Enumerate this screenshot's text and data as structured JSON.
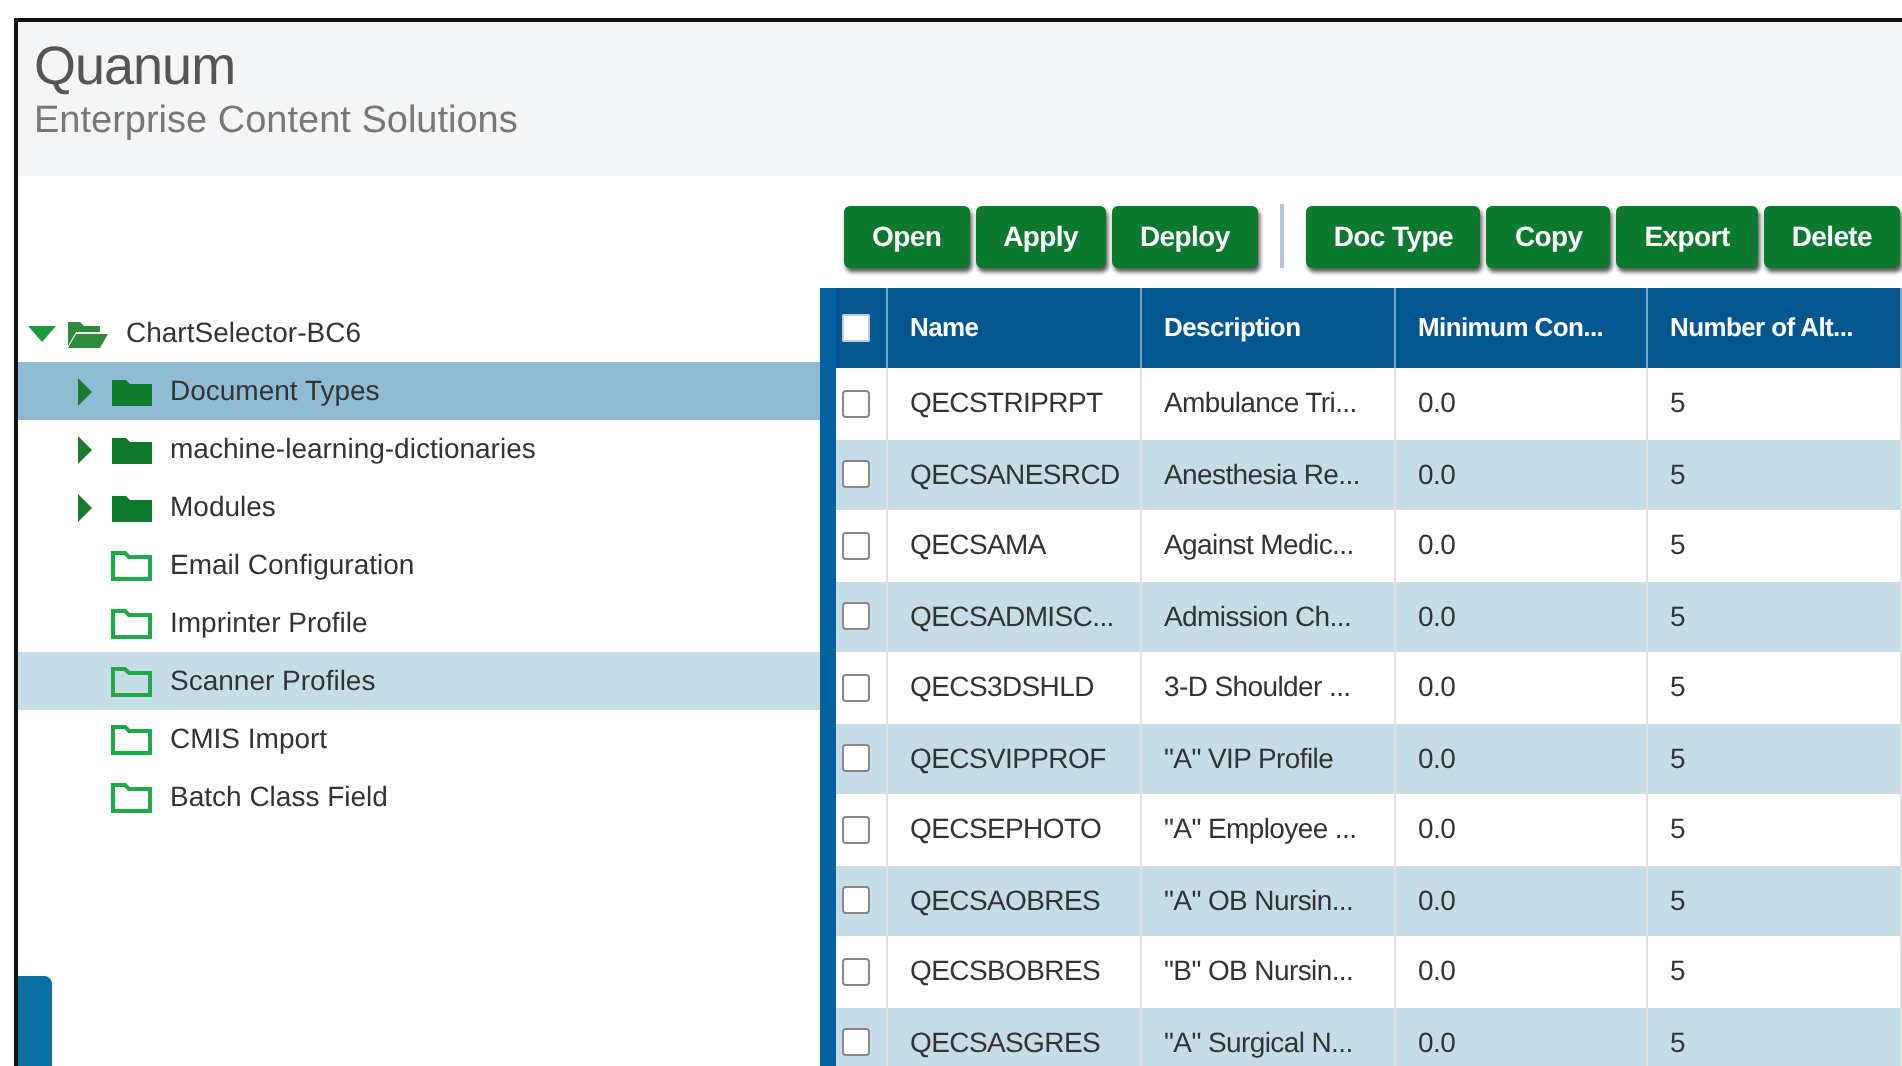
{
  "header": {
    "brand": "Quanum",
    "subtitle": "Enterprise Content Solutions"
  },
  "tree": [
    {
      "label": "ChartSelector-BC6",
      "expandable": true,
      "expanded": true,
      "selected": false,
      "hovered": false,
      "children": [
        {
          "label": "Document Types",
          "expandable": true,
          "expanded": false,
          "selected": true,
          "hovered": false
        },
        {
          "label": "machine-learning-dictionaries",
          "expandable": true,
          "expanded": false,
          "selected": false,
          "hovered": false
        },
        {
          "label": "Modules",
          "expandable": true,
          "expanded": false,
          "selected": false,
          "hovered": false
        },
        {
          "label": "Email Configuration",
          "expandable": false,
          "selected": false,
          "hovered": false
        },
        {
          "label": "Imprinter Profile",
          "expandable": false,
          "selected": false,
          "hovered": false
        },
        {
          "label": "Scanner Profiles",
          "expandable": false,
          "selected": false,
          "hovered": true
        },
        {
          "label": "CMIS Import",
          "expandable": false,
          "selected": false,
          "hovered": false
        },
        {
          "label": "Batch Class Field",
          "expandable": false,
          "selected": false,
          "hovered": false
        }
      ]
    }
  ],
  "toolbar": [
    [
      "Open",
      "Apply",
      "Deploy"
    ],
    [
      "Doc Type",
      "Copy",
      "Export",
      "Delete"
    ]
  ],
  "table": {
    "all_checked": false,
    "columns": [
      "Name",
      "Description",
      "Minimum Con...",
      "Number of Alt..."
    ],
    "rows": [
      {
        "checked": false,
        "cells": [
          "QECSTRIPRPT",
          "Ambulance Tri...",
          "0.0",
          "5"
        ]
      },
      {
        "checked": false,
        "cells": [
          "QECSANESRCD",
          "Anesthesia Re...",
          "0.0",
          "5"
        ]
      },
      {
        "checked": false,
        "cells": [
          "QECSAMA",
          "Against Medic...",
          "0.0",
          "5"
        ]
      },
      {
        "checked": false,
        "cells": [
          "QECSADMISC...",
          "Admission Ch...",
          "0.0",
          "5"
        ]
      },
      {
        "checked": false,
        "cells": [
          "QECS3DSHLD",
          "3-D Shoulder ...",
          "0.0",
          "5"
        ]
      },
      {
        "checked": false,
        "cells": [
          "QECSVIPPROF",
          "\"A\" VIP Profile",
          "0.0",
          "5"
        ]
      },
      {
        "checked": false,
        "cells": [
          "QECSEPHOTO",
          "\"A\" Employee ...",
          "0.0",
          "5"
        ]
      },
      {
        "checked": false,
        "cells": [
          "QECSAOBRES",
          "\"A\" OB Nursin...",
          "0.0",
          "5"
        ]
      },
      {
        "checked": false,
        "cells": [
          "QECSBOBRES",
          "\"B\" OB Nursin...",
          "0.0",
          "5"
        ]
      },
      {
        "checked": false,
        "cells": [
          "QECSASGRES",
          "\"A\" Surgical N...",
          "0.0",
          "5"
        ]
      }
    ]
  }
}
